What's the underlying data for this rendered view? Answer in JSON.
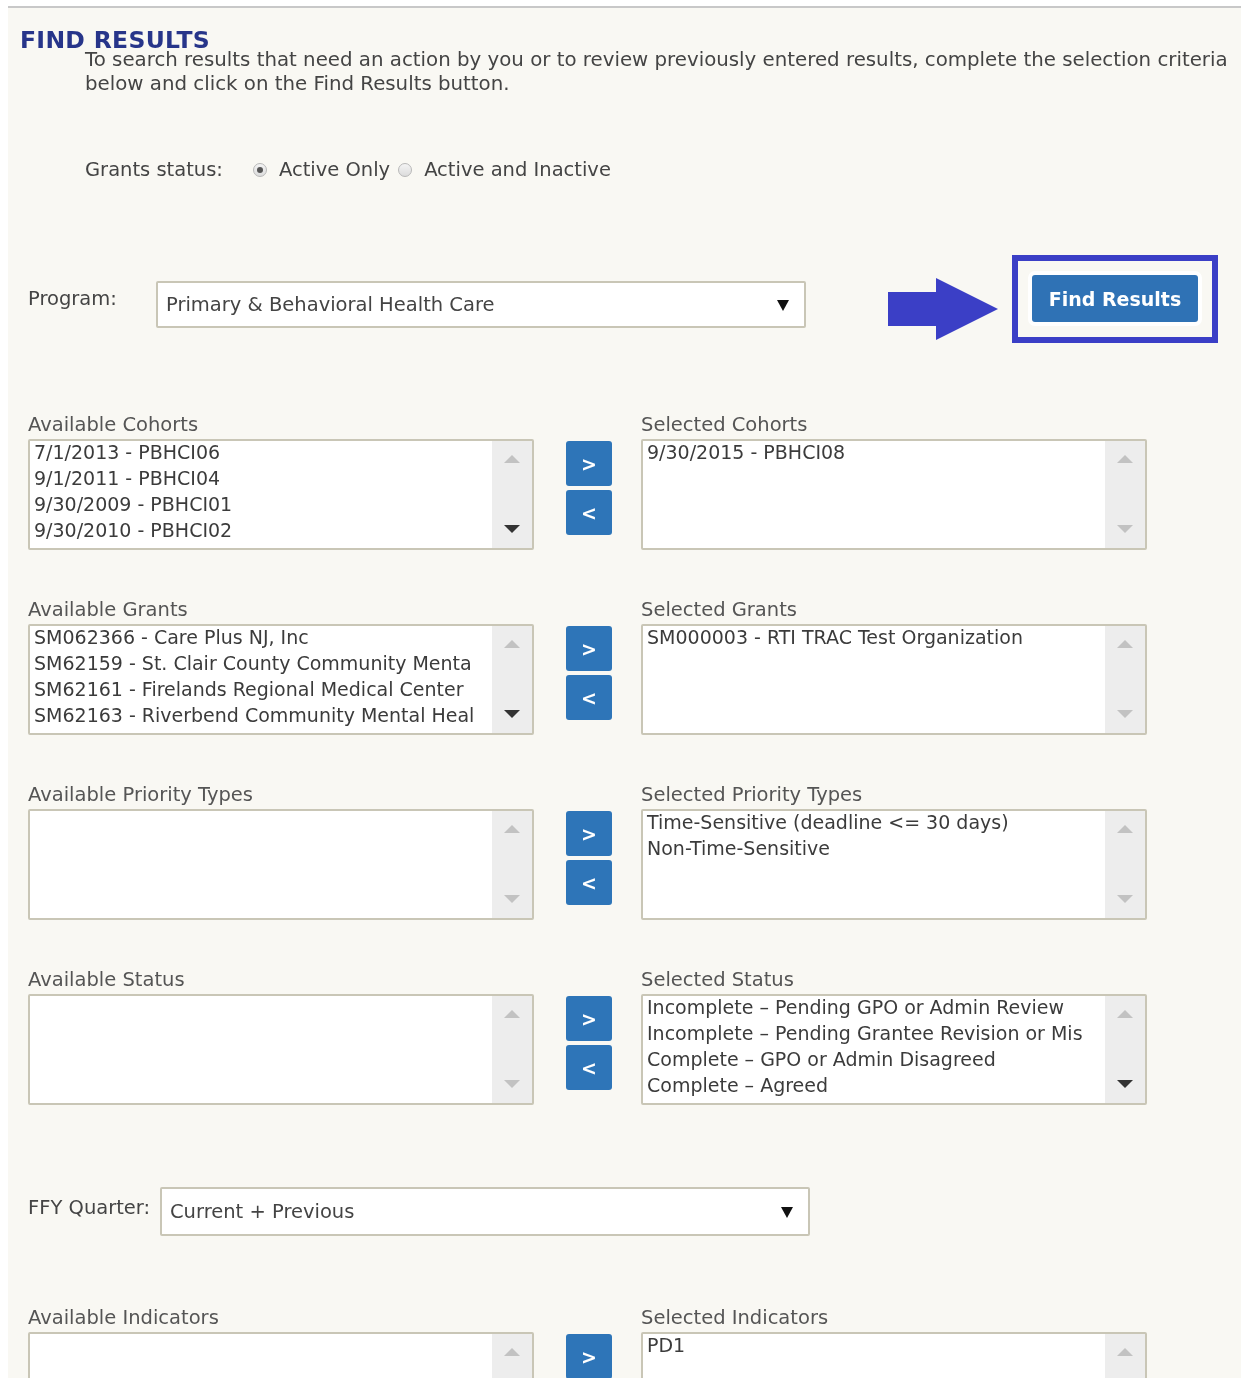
{
  "page_title": "FIND RESULTS",
  "description": "To search results that need an action by you or to review previously entered results, complete the selection criteria below and click on the Find Results button.",
  "grants_status": {
    "label": "Grants status:",
    "options": [
      {
        "label": "Active Only",
        "selected": true
      },
      {
        "label": "Active and Inactive",
        "selected": false
      }
    ]
  },
  "program": {
    "label": "Program:",
    "value": "Primary & Behavioral Health Care"
  },
  "find_button": "Find Results",
  "pickers": [
    {
      "available": {
        "label": "Available Cohorts",
        "items": [
          "7/1/2013 - PBHCI06",
          "9/1/2011 - PBHCI04",
          "9/30/2009 - PBHCI01",
          "9/30/2010 - PBHCI02"
        ]
      },
      "selected": {
        "label": "Selected Cohorts",
        "items": [
          "9/30/2015 - PBHCI08"
        ]
      },
      "move_buttons": [
        ">",
        "<"
      ]
    },
    {
      "available": {
        "label": "Available Grants",
        "items": [
          "SM062366 - Care Plus NJ, Inc",
          "SM62159 - St. Clair County Community Menta",
          "SM62161 - Firelands Regional Medical Center",
          "SM62163 - Riverbend Community Mental Heal"
        ]
      },
      "selected": {
        "label": "Selected Grants",
        "items": [
          "SM000003 - RTI TRAC Test Organization"
        ]
      },
      "move_buttons": [
        ">",
        "<"
      ]
    },
    {
      "available": {
        "label": "Available Priority Types"
      },
      "selected": {
        "label": "Selected Priority Types",
        "items": [
          "Time-Sensitive (deadline <= 30 days)",
          "Non-Time-Sensitive"
        ]
      },
      "move_buttons": [
        ">",
        "<"
      ]
    },
    {
      "available": {
        "label": "Available Status"
      },
      "selected": {
        "label": "Selected Status",
        "items": [
          "Incomplete – Pending GPO or Admin Review",
          "Incomplete – Pending Grantee Revision or Mis",
          "Complete – GPO or Admin Disagreed",
          "Complete – Agreed"
        ]
      },
      "move_buttons": [
        ">",
        "<"
      ]
    }
  ],
  "ffy_quarter": {
    "label": "FFY Quarter:",
    "value": "Current + Previous"
  },
  "indicator_picker": {
    "available": {
      "label": "Available Indicators"
    },
    "selected": {
      "label": "Selected Indicators",
      "items": [
        "PD1"
      ]
    },
    "move_buttons": [
      ">"
    ]
  }
}
